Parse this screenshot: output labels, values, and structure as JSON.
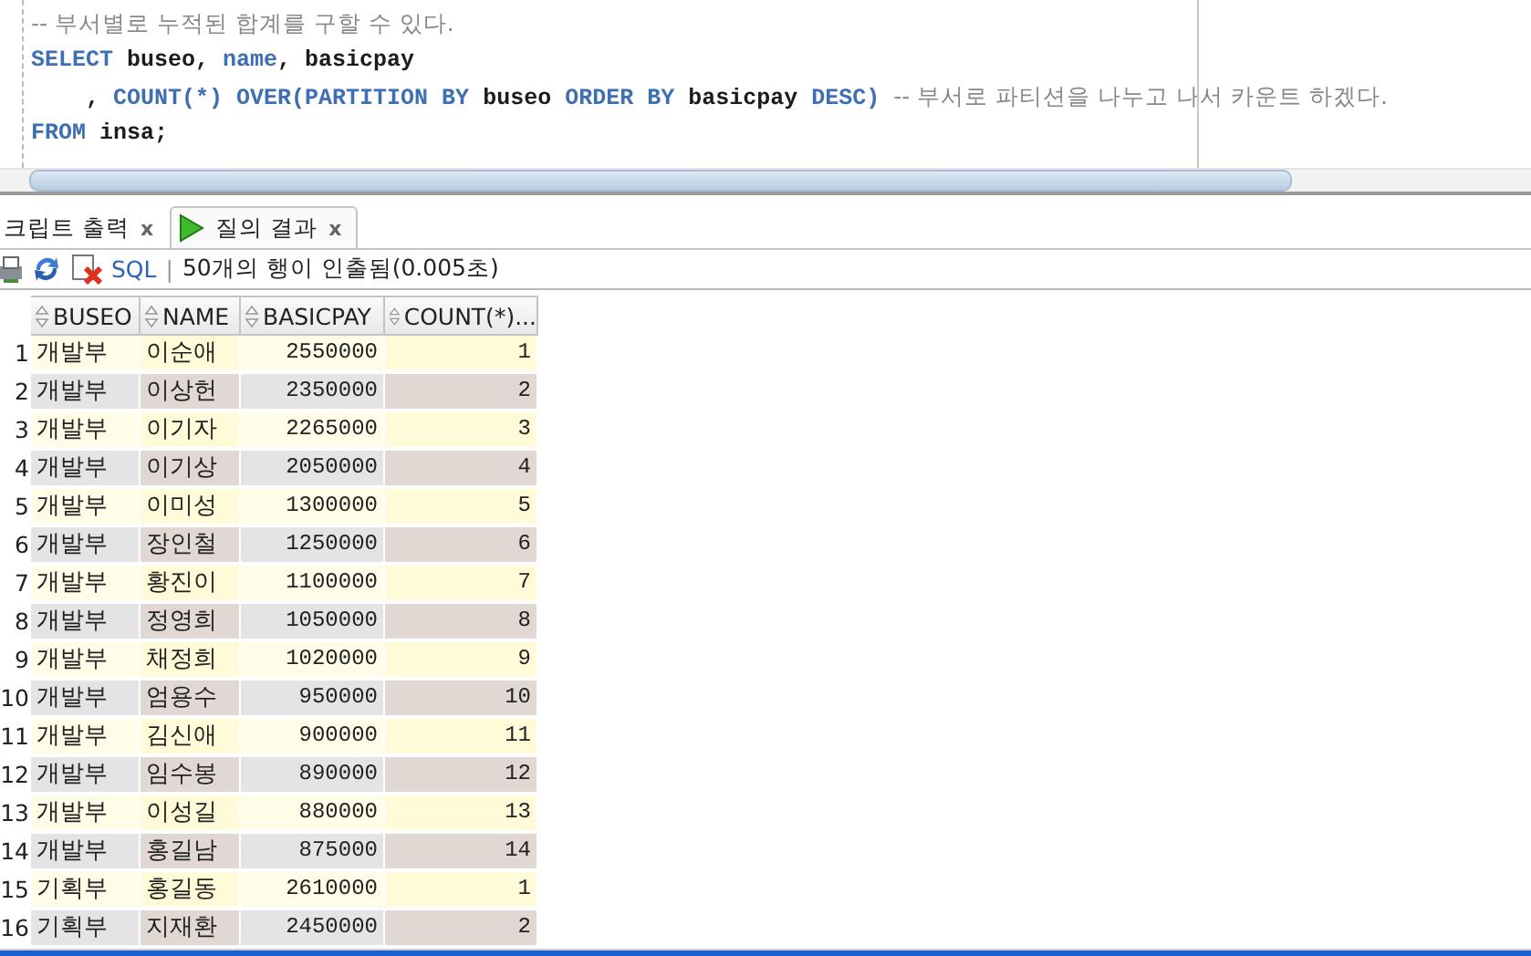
{
  "editor": {
    "lines": [
      [
        {
          "kind": "comment",
          "text": "-- 부서별로 누적된 합계를 구할 수 있다."
        }
      ],
      [
        {
          "kind": "keyword",
          "text": "SELECT"
        },
        {
          "kind": "plain",
          "text": " buseo, "
        },
        {
          "kind": "keyword",
          "text": "name"
        },
        {
          "kind": "plain",
          "text": ", basicpay"
        }
      ],
      [
        {
          "kind": "plain",
          "text": "    , "
        },
        {
          "kind": "keyword",
          "text": "COUNT(*) OVER(PARTITION BY"
        },
        {
          "kind": "plain",
          "text": " buseo "
        },
        {
          "kind": "keyword",
          "text": "ORDER BY"
        },
        {
          "kind": "plain",
          "text": " basicpay "
        },
        {
          "kind": "keyword",
          "text": "DESC)"
        },
        {
          "kind": "comment",
          "text": "-- 부서로 파티션을 나누고 나서 카운트 하겠다."
        }
      ],
      [
        {
          "kind": "keyword",
          "text": "FROM"
        },
        {
          "kind": "plain",
          "text": " insa;"
        }
      ]
    ]
  },
  "tabs": [
    {
      "label": "크립트 출력",
      "close": "x",
      "selected": false,
      "kind": "script"
    },
    {
      "label": "질의 결과",
      "close": "x",
      "selected": true,
      "kind": "query"
    }
  ],
  "toolbar": {
    "sql": "SQL",
    "separator": "|",
    "status": "50개의 행이 인출됨(0.005초)"
  },
  "table": {
    "columns": [
      "",
      "BUSEO",
      "NAME",
      "BASICPAY",
      "COUNT(*)..."
    ],
    "rows": [
      [
        "1",
        "개발부",
        "이순애",
        "2550000",
        "1"
      ],
      [
        "2",
        "개발부",
        "이상헌",
        "2350000",
        "2"
      ],
      [
        "3",
        "개발부",
        "이기자",
        "2265000",
        "3"
      ],
      [
        "4",
        "개발부",
        "이기상",
        "2050000",
        "4"
      ],
      [
        "5",
        "개발부",
        "이미성",
        "1300000",
        "5"
      ],
      [
        "6",
        "개발부",
        "장인철",
        "1250000",
        "6"
      ],
      [
        "7",
        "개발부",
        "황진이",
        "1100000",
        "7"
      ],
      [
        "8",
        "개발부",
        "정영희",
        "1050000",
        "8"
      ],
      [
        "9",
        "개발부",
        "채정희",
        "1020000",
        "9"
      ],
      [
        "10",
        "개발부",
        "엄용수",
        "950000",
        "10"
      ],
      [
        "11",
        "개발부",
        "김신애",
        "900000",
        "11"
      ],
      [
        "12",
        "개발부",
        "임수봉",
        "890000",
        "12"
      ],
      [
        "13",
        "개발부",
        "이성길",
        "880000",
        "13"
      ],
      [
        "14",
        "개발부",
        "홍길남",
        "875000",
        "14"
      ],
      [
        "15",
        "기획부",
        "홍길동",
        "2610000",
        "1"
      ],
      [
        "16",
        "기획부",
        "지재환",
        "2450000",
        "2"
      ]
    ]
  }
}
